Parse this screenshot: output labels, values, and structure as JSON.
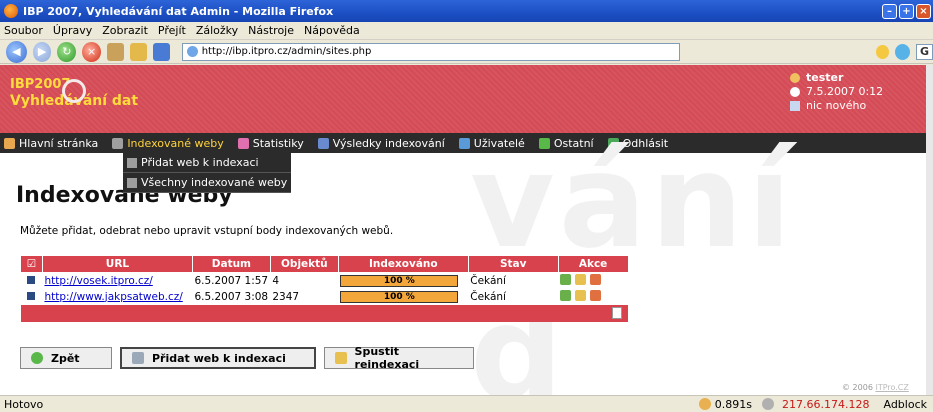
{
  "window": {
    "title": "IBP 2007, Vyhledávání dat Admin - Mozilla Firefox"
  },
  "menu": [
    "Soubor",
    "Úpravy",
    "Zobrazit",
    "Přejít",
    "Záložky",
    "Nástroje",
    "Nápověda"
  ],
  "address": {
    "url": "http://ibp.itpro.cz/admin/sites.php"
  },
  "header": {
    "logo_line1": "IBP2007",
    "logo_line2": "Vyhledávání dat",
    "user": "tester",
    "datetime": "7.5.2007 0:12",
    "news": "nic nového"
  },
  "nav": {
    "home": "Hlavní stránka",
    "indexed": "Indexované weby",
    "stats": "Statistiky",
    "results": "Výsledky indexování",
    "users": "Uživatelé",
    "other": "Ostatní",
    "logout": "Odhlásit"
  },
  "dropdown": {
    "add": "Přidat web k indexaci",
    "all": "Všechny indexované weby"
  },
  "page": {
    "title": "Indexované weby",
    "intro": "Můžete přidat, odebrat nebo upravit vstupní body indexovaných webů.",
    "watermark": "vání d"
  },
  "table": {
    "headers": {
      "url": "URL",
      "date": "Datum",
      "objects": "Objektů",
      "indexed": "Indexováno",
      "state": "Stav",
      "actions": "Akce"
    },
    "rows": [
      {
        "url": "http://vosek.itpro.cz/",
        "date": "6.5.2007 1:57",
        "objects": "4",
        "progress": "100 %",
        "progress_fraction": 1.0,
        "state": "Čekání"
      },
      {
        "url": "http://www.jakpsatweb.cz/",
        "date": "6.5.2007 3:08",
        "objects": "2347",
        "progress": "100 %",
        "progress_fraction": 1.0,
        "state": "Čekání"
      }
    ]
  },
  "buttons": {
    "back": "Zpět",
    "add": "Přidat web k indexaci",
    "reindex": "Spustit reindexaci"
  },
  "footer": {
    "copyright": "© 2006 ",
    "copyright_link": "ITPro.CZ"
  },
  "status": {
    "text": "Hotovo",
    "time": "0.891s",
    "ip": "217.66.174.128",
    "adblock": "Adblock"
  },
  "colors": {
    "header_red": "#d44a55",
    "nav_dark": "#2b2b2b",
    "accent_yellow": "#ffd23c",
    "progress_orange": "#f3a73a"
  }
}
